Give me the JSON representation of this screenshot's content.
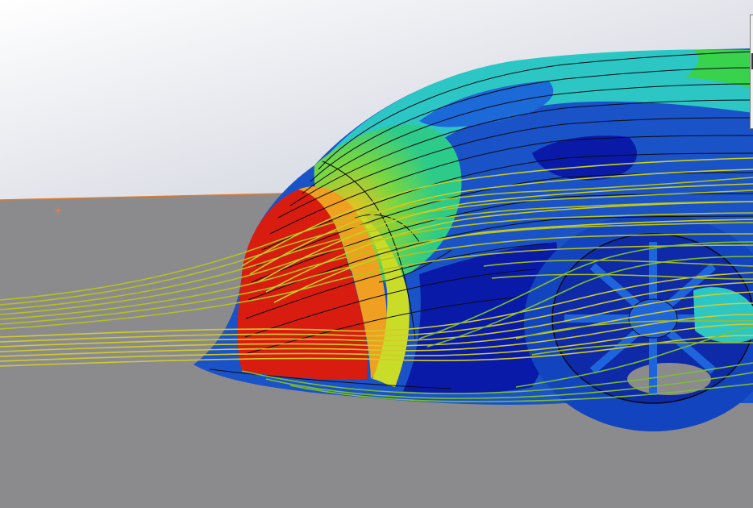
{
  "viewport": {
    "background_top": "#ffffff",
    "background_bottom": "#cfd1dc",
    "ground_color": "#8b8b8d",
    "horizon_line_color": "#e07a2c",
    "origin_marker_color": "#f08040",
    "origin_marker_glyph": "+"
  },
  "model": {
    "icon": "car-body-icon",
    "contour_colors": {
      "stagnation": "#d81c10",
      "high": "#f0a020",
      "mid_high": "#c8dc28",
      "mid": "#3cd25a",
      "mid_low": "#20c8c8",
      "low": "#1e64dc",
      "min": "#0a1aa8"
    },
    "mesh_line_color": "#0a0a14"
  },
  "streamlines": {
    "icon": "flow-streamline-icon",
    "colors": [
      "#b6c21a",
      "#c9cf20",
      "#9ebd20",
      "#d0cc2c",
      "#7cbf30"
    ]
  }
}
